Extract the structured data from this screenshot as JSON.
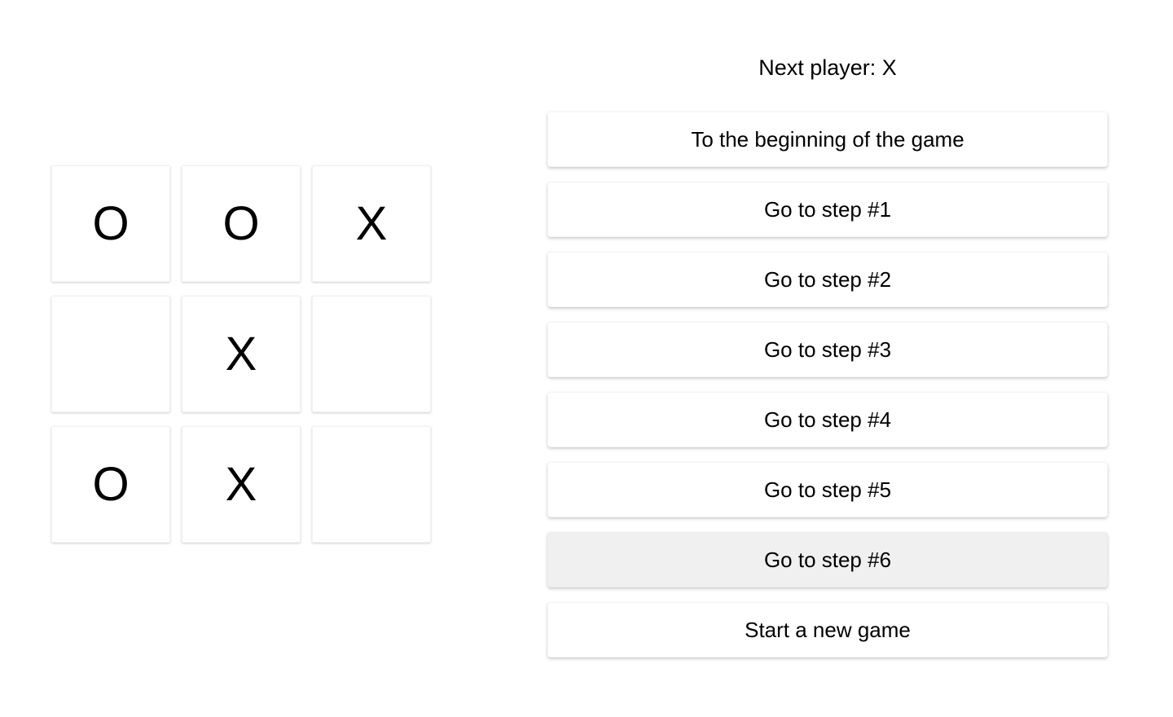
{
  "page": {
    "background_color": "#ffffff",
    "text_color": "#000000"
  },
  "board": {
    "rows": [
      {
        "cells": [
          {
            "value": "O",
            "name": "square-0"
          },
          {
            "value": "O",
            "name": "square-1"
          },
          {
            "value": "X",
            "name": "square-2"
          }
        ]
      },
      {
        "cells": [
          {
            "value": "",
            "name": "square-3"
          },
          {
            "value": "X",
            "name": "square-4"
          },
          {
            "value": "",
            "name": "square-5"
          }
        ]
      },
      {
        "cells": [
          {
            "value": "O",
            "name": "square-6"
          },
          {
            "value": "X",
            "name": "square-7"
          },
          {
            "value": "",
            "name": "square-8"
          }
        ]
      }
    ]
  },
  "info": {
    "status": "Next player: X",
    "next_player_symbol": "X",
    "moves": [
      {
        "label": "To the beginning of the game",
        "active": false
      },
      {
        "label": "Go to step #1",
        "active": false
      },
      {
        "label": "Go to step #2",
        "active": false
      },
      {
        "label": "Go to step #3",
        "active": false
      },
      {
        "label": "Go to step #4",
        "active": false
      },
      {
        "label": "Go to step #5",
        "active": false
      },
      {
        "label": "Go to step #6",
        "active": true
      },
      {
        "label": "Start a new game",
        "active": false
      }
    ],
    "active_button_color": "#f0f0f0",
    "button_color": "#ffffff"
  }
}
